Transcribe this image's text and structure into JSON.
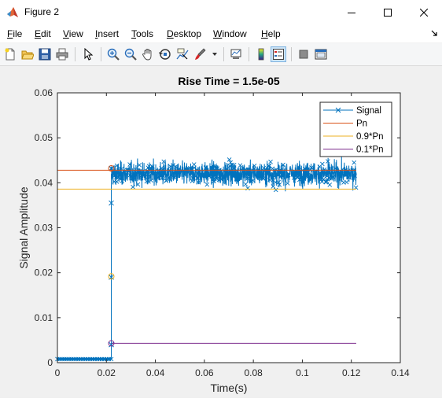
{
  "window": {
    "title": "Figure 2",
    "controls": [
      "minimize",
      "maximize",
      "close"
    ]
  },
  "menubar": {
    "items": [
      {
        "label": "File",
        "key": "F",
        "rest": "ile"
      },
      {
        "label": "Edit",
        "key": "E",
        "rest": "dit"
      },
      {
        "label": "View",
        "key": "V",
        "rest": "iew"
      },
      {
        "label": "Insert",
        "key": "I",
        "rest": "nsert"
      },
      {
        "label": "Tools",
        "key": "T",
        "rest": "ools"
      },
      {
        "label": "Desktop",
        "key": "D",
        "rest": "esktop"
      },
      {
        "label": "Window",
        "key": "W",
        "rest": "indow"
      },
      {
        "label": "Help",
        "key": "H",
        "rest": "elp"
      }
    ]
  },
  "toolbar": {
    "buttons": [
      "new-figure-icon",
      "open-file-icon",
      "save-icon",
      "print-icon",
      "edit-plot-arrow-icon",
      "zoom-in-icon",
      "zoom-out-icon",
      "pan-hand-icon",
      "rotate-3d-icon",
      "data-cursor-icon",
      "brush-icon",
      "link-plot-icon",
      "colorbar-icon",
      "legend-icon",
      "hide-plot-tools-icon",
      "show-plot-tools-icon"
    ]
  },
  "colors": {
    "signal": "#0072bd",
    "pn": "#d95319",
    "pn90": "#edb120",
    "pn10": "#7e2f8e"
  },
  "chart_data": {
    "type": "line",
    "title": "Rise Time = 1.5e-05",
    "xlabel": "Time(s)",
    "ylabel": "Signal Amplitude",
    "xlim": [
      0,
      0.14
    ],
    "ylim": [
      0,
      0.06
    ],
    "xticks": [
      "0",
      "0.02",
      "0.04",
      "0.06",
      "0.08",
      "0.1",
      "0.12",
      "0.14"
    ],
    "yticks": [
      "0",
      "0.01",
      "0.02",
      "0.03",
      "0.04",
      "0.05",
      "0.06"
    ],
    "grid": false,
    "legend_position": "top-right",
    "series": [
      {
        "name": "Signal",
        "marker": "x",
        "description": "noisy step",
        "baseline_level": 0.0008,
        "step_time": 0.022,
        "step_points": [
          [
            0.022,
            0.004
          ],
          [
            0.022,
            0.019
          ],
          [
            0.022,
            0.0355
          ],
          [
            0.022,
            0.0432
          ]
        ],
        "plateau_mean": 0.042,
        "plateau_min": 0.0335,
        "plateau_max": 0.0525,
        "x_end": 0.122
      },
      {
        "name": "Pn",
        "y": 0.0428,
        "x": [
          0,
          0.122
        ]
      },
      {
        "name": "0.9*Pn",
        "y": 0.0386,
        "x": [
          0,
          0.122
        ]
      },
      {
        "name": "0.1*Pn",
        "y": 0.0043,
        "x": [
          0.022,
          0.122
        ]
      }
    ]
  }
}
